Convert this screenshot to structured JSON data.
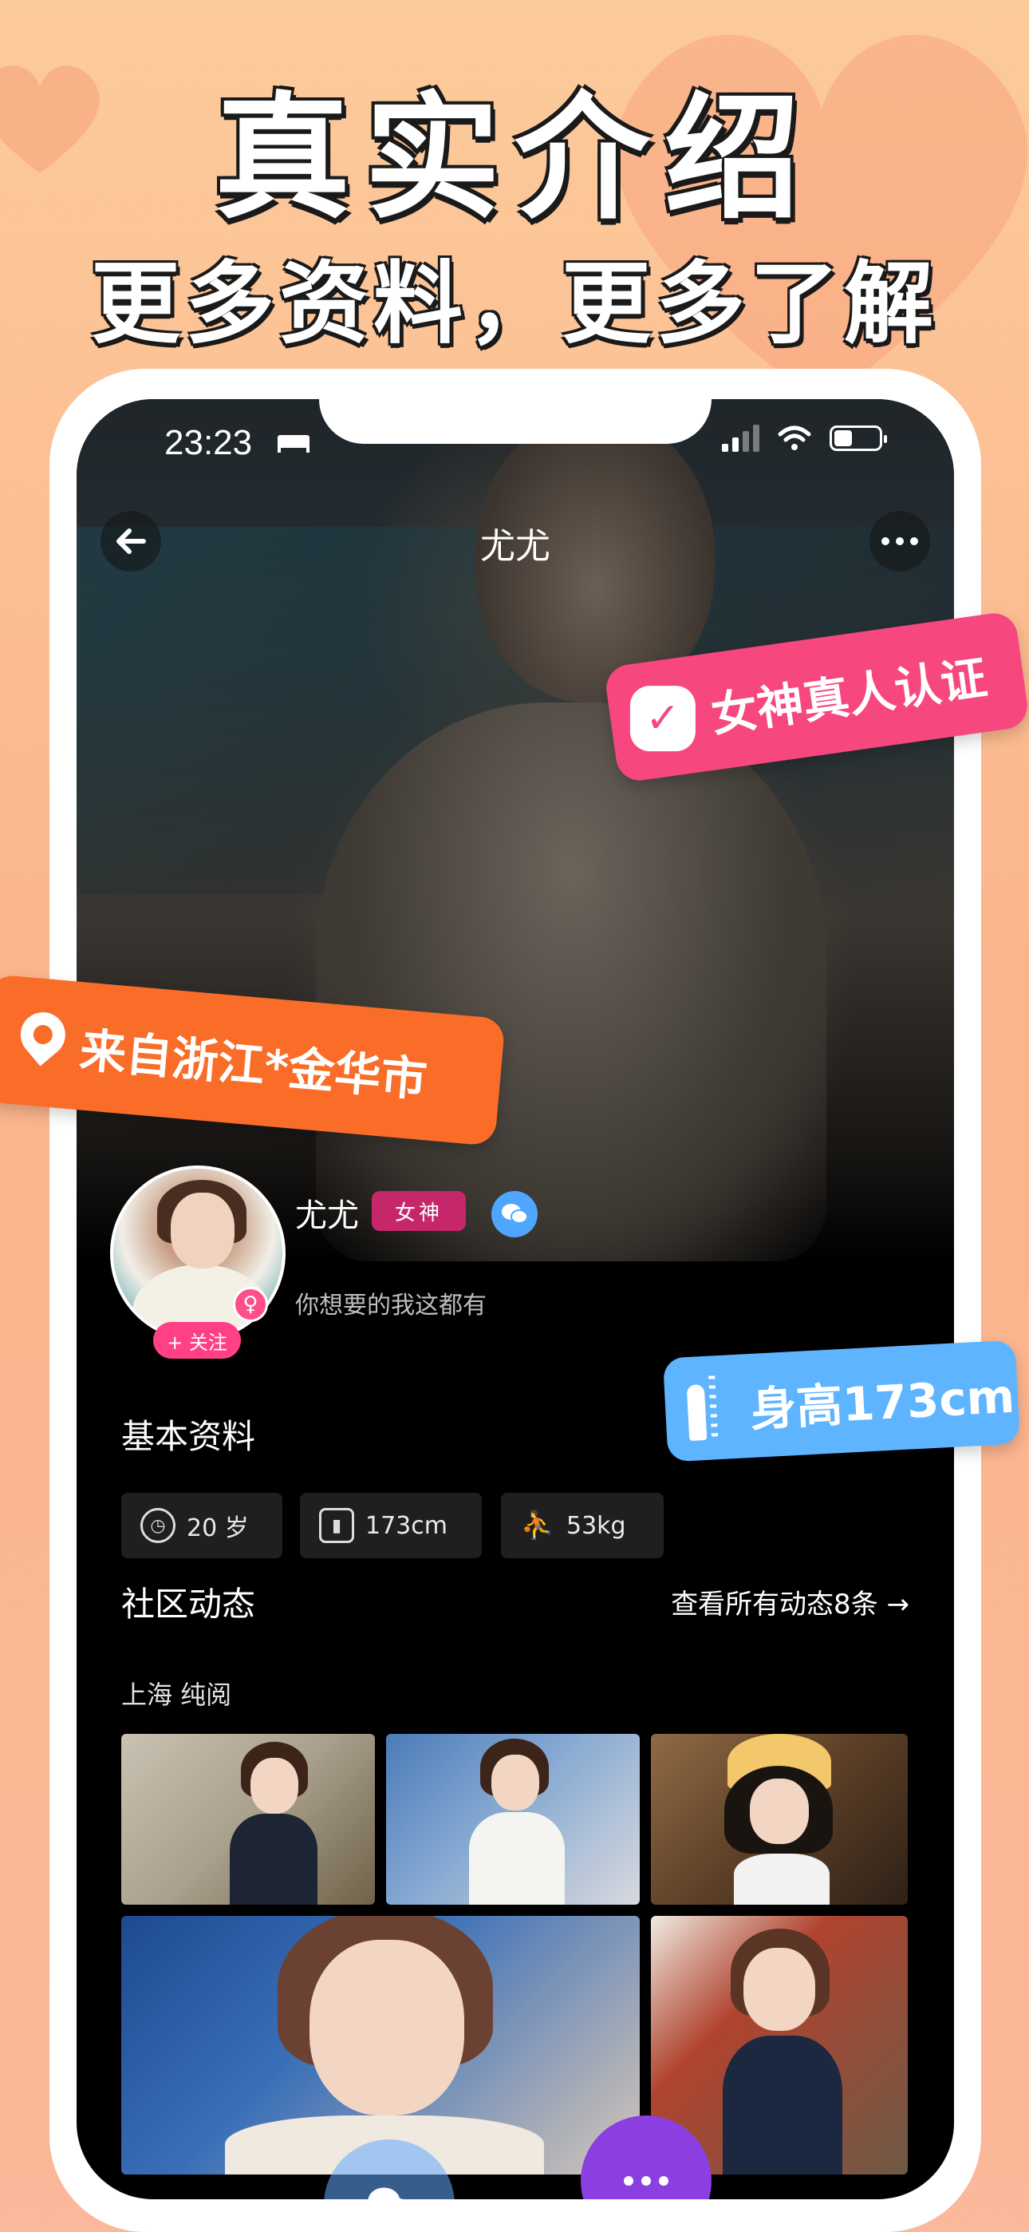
{
  "promo": {
    "title": "真实介绍",
    "subtitle": "更多资料，更多了解"
  },
  "status_bar": {
    "time": "23:23",
    "sleep_icon": "bed-icon",
    "wifi_icon": "wifi-icon",
    "battery_level_percent": 40
  },
  "nav": {
    "back_icon": "arrow-left-icon",
    "title": "尤尤",
    "more_icon": "ellipsis-icon"
  },
  "profile": {
    "name": "尤尤",
    "badge": "女神",
    "bio": "你想要的我这都有",
    "follow_label": "+ 关注",
    "gender_icon": "female-icon",
    "wechat_icon": "wechat-icon"
  },
  "basic_info": {
    "title": "基本资料",
    "chips": [
      {
        "icon": "clock-icon",
        "label": "20 岁"
      },
      {
        "icon": "height-icon",
        "label": "173cm"
      },
      {
        "icon": "weight-icon",
        "label": "53kg"
      }
    ]
  },
  "community": {
    "title": "社区动态",
    "view_all": "查看所有动态8条 →",
    "location": "上海  纯阅"
  },
  "floating_tags": {
    "verify": "女神真人认证",
    "location": "来自浙江*金华市",
    "height": "身高173cm"
  },
  "colors": {
    "background_top": "#fccb9b",
    "verify_tag": "#f7477f",
    "location_tag": "#fa6d29",
    "height_tag": "#5fb4ff",
    "goddess_badge": "#c6266a",
    "follow_button": "#ff3f86"
  }
}
